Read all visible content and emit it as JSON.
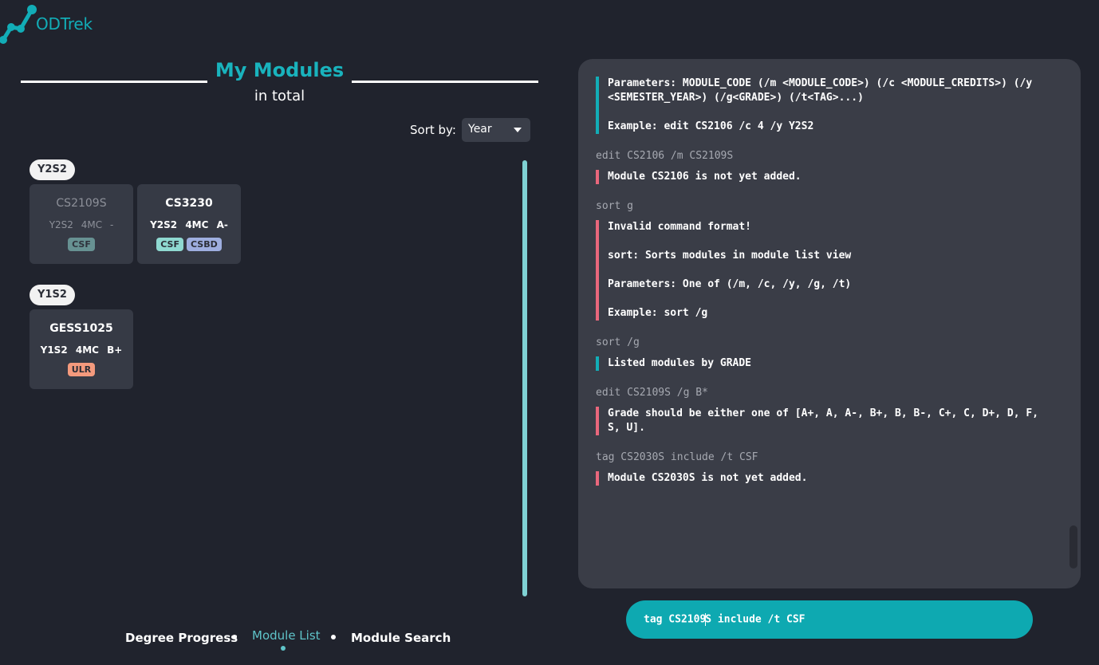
{
  "app": {
    "name": "ODTrek",
    "accent": "#12adb7",
    "error_color": "#e9677c"
  },
  "header": {
    "title": "My Modules",
    "subtitle": "in total"
  },
  "sort": {
    "label": "Sort by:",
    "selected": "Year"
  },
  "groups": [
    {
      "label": "Y2S2",
      "modules": [
        {
          "code": "CS2109S",
          "year": "Y2S2",
          "credits": "4MC",
          "grade": "-",
          "tags": [
            "CSF"
          ]
        },
        {
          "code": "CS3230",
          "year": "Y2S2",
          "credits": "4MC",
          "grade": "A-",
          "tags": [
            "CSF",
            "CSBD"
          ]
        }
      ]
    },
    {
      "label": "Y1S2",
      "modules": [
        {
          "code": "GESS1025",
          "year": "Y1S2",
          "credits": "4MC",
          "grade": "B+",
          "tags": [
            "ULR"
          ]
        }
      ]
    }
  ],
  "tag_colors": {
    "CSF": "#8fd9d1",
    "CSBD": "#9eaedf",
    "ULR": "#f49a7d"
  },
  "nav": {
    "degree_progress": "Degree Progress",
    "module_list": "Module List",
    "module_search": "Module Search"
  },
  "console": {
    "entries": [
      {
        "command": "",
        "status": "ok",
        "lines": [
          "Parameters: MODULE_CODE (/m <MODULE_CODE>) (/c <MODULE_CREDITS>) (/y <SEMESTER_YEAR>) (/g<GRADE>) (/t<TAG>...)",
          "Example: edit CS2106 /c 4 /y Y2S2"
        ]
      },
      {
        "command": "edit CS2106 /m CS2109S",
        "status": "error",
        "lines": [
          "Module CS2106 is not yet added."
        ]
      },
      {
        "command": "sort g",
        "status": "error",
        "lines": [
          "Invalid command format!",
          "sort: Sorts modules in module list view",
          "Parameters: One of (/m, /c, /y, /g, /t)",
          "Example: sort /g"
        ]
      },
      {
        "command": "sort /g",
        "status": "ok",
        "lines": [
          "Listed modules by GRADE"
        ]
      },
      {
        "command": "edit CS2109S /g B*",
        "status": "error",
        "lines": [
          "Grade should be either one of [A+, A, A-, B+, B, B-, C+, C, D+, D, F, S, U]."
        ]
      },
      {
        "command": "tag CS2030S include /t CSF",
        "status": "error",
        "lines": [
          "Module CS2030S is not yet added."
        ]
      }
    ]
  },
  "input": {
    "value_before_cursor": "tag CS2109",
    "value_after_cursor": "S include /t CSF"
  }
}
